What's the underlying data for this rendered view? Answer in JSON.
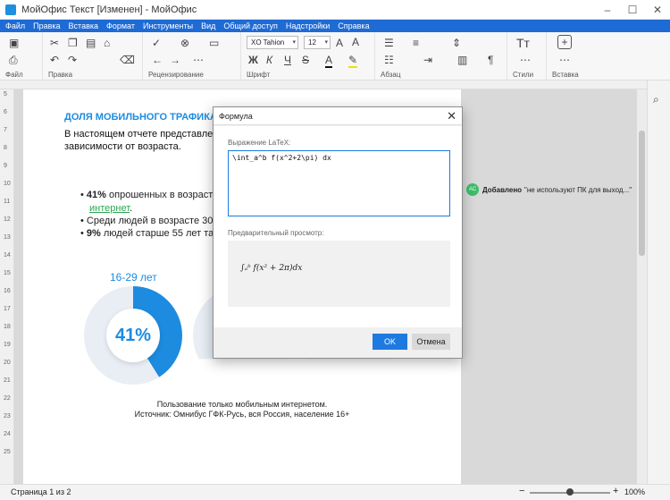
{
  "window": {
    "title": "МойОфис Текст [Изменен] - МойОфис",
    "min": "–",
    "max": "☐",
    "close": "✕"
  },
  "menu": [
    "Файл",
    "Правка",
    "Вставка",
    "Формат",
    "Инструменты",
    "Вид",
    "Общий доступ",
    "Надстройки",
    "Справка"
  ],
  "toolbar": {
    "groups": {
      "file": "Файл",
      "edit": "Правка",
      "review": "Рецензирование",
      "font": "Шрифт",
      "paragraph": "Абзац",
      "styles": "Стили",
      "insert": "Вставка"
    },
    "font_name": "XO Tahion",
    "font_size": "12",
    "bold": "Ж",
    "italic": "К",
    "underline": "Ч",
    "strike": "S",
    "more": "⋯",
    "paragraph_mark": "¶",
    "styles_icon": "Tт",
    "insert_icon": "+"
  },
  "ruler_numbers": [
    "5",
    "6",
    "7",
    "8",
    "9",
    "10",
    "11",
    "12",
    "13",
    "14",
    "15",
    "16",
    "17",
    "18",
    "19",
    "20",
    "21",
    "22",
    "23",
    "24",
    "25"
  ],
  "document": {
    "heading": "ДОЛЯ МОБИЛЬНОГО ТРАФИКА",
    "para1": "В настоящем отчете представлена с",
    "para2": "зависимости от возраста.",
    "b1_bold": "41%",
    "b1_text": " опрошенных в возрасте",
    "b1_link": "интернет",
    "b1_end": ".",
    "b2_text": "Среди людей в возрасте 30-5",
    "b3_bold": "9%",
    "b3_text": " людей старше 55 лет так",
    "donut_label": "16-29 лет",
    "donut_pct": "41%",
    "donut_value": 0.41,
    "caption1": "Пользование только мобильным интернетом.",
    "caption2": "Источник: Омнибус ГФК-Русь, вся Россия, население 16+"
  },
  "comment": {
    "avatar": "AC",
    "action": "Добавлено",
    "text": "\"не используют ПК для выход...\""
  },
  "dialog": {
    "title": "Формула",
    "latex_label": "Выражение LaTeX:",
    "latex_value": "\\int_a^b f(x^2+2\\pi) dx",
    "preview_label": "Предварительный просмотр:",
    "preview_formula": "∫ₐᵇ f(x² + 2π)dx",
    "ok": "OK",
    "cancel": "Отмена"
  },
  "status": {
    "pages": "Страница 1 из 2",
    "zoom": "100%",
    "zoom_minus": "−",
    "zoom_plus": "+"
  },
  "colors": {
    "accent": "#1d8be0",
    "menubar": "#1e6bd6",
    "link": "#2aa552",
    "ok_button": "#1e7ae0"
  }
}
